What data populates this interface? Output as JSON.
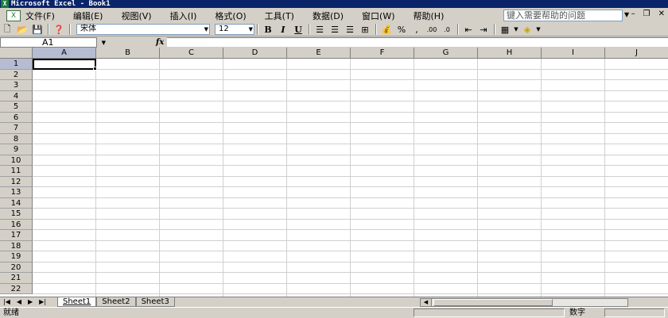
{
  "window": {
    "title": "Microsoft Excel - Book1"
  },
  "menu": [
    "文件(F)",
    "编辑(E)",
    "视图(V)",
    "插入(I)",
    "格式(O)",
    "工具(T)",
    "数据(D)",
    "窗口(W)",
    "帮助(H)"
  ],
  "help_box": {
    "placeholder": "键入需要帮助的问题"
  },
  "toolbar": {
    "font_name": "宋体",
    "font_size": "12",
    "bold_label": "B",
    "italic_label": "I",
    "underline_label": "U",
    "percent_label": "%",
    "comma_label": ","
  },
  "formula_bar": {
    "name_box": "A1",
    "fx_label": "fx",
    "content": ""
  },
  "columns": [
    "A",
    "B",
    "C",
    "D",
    "E",
    "F",
    "G",
    "H",
    "I",
    "J"
  ],
  "rows": [
    "1",
    "2",
    "3",
    "4",
    "5",
    "6",
    "7",
    "8",
    "9",
    "10",
    "11",
    "12",
    "13",
    "14",
    "15",
    "16",
    "17",
    "18",
    "19",
    "20",
    "21",
    "22"
  ],
  "selected_cell": "A1",
  "sheets": [
    {
      "name": "Sheet1",
      "active": true
    },
    {
      "name": "Sheet2",
      "active": false
    },
    {
      "name": "Sheet3",
      "active": false
    }
  ],
  "status": {
    "ready": "就绪",
    "mode": "数字"
  }
}
